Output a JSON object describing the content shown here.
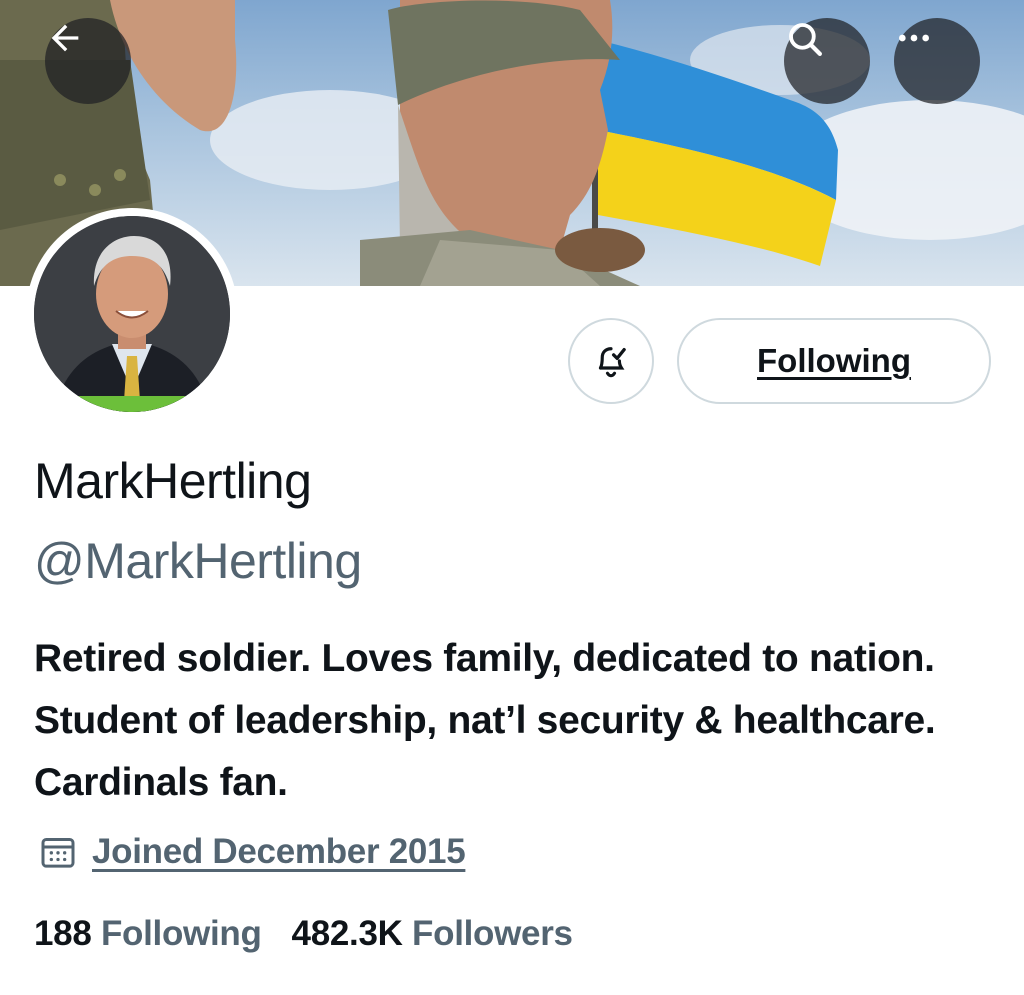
{
  "header": {
    "back_icon": "arrow-left-icon",
    "search_icon": "search-icon",
    "more_icon": "more-horizontal-icon"
  },
  "profile": {
    "display_name": "MarkHertling",
    "handle": "@MarkHertling",
    "bio": "Retired soldier. Loves family, dedicated to nation. Student of leadership, nat’l security & healthcare. Cardinals fan.",
    "joined": "Joined December 2015",
    "joined_icon": "calendar-icon"
  },
  "actions": {
    "notifications_icon": "bell-subscribed-icon",
    "following_label": "Following"
  },
  "stats": {
    "following_count": "188",
    "following_label": "Following",
    "followers_count": "482.3K",
    "followers_label": "Followers"
  },
  "colors": {
    "text_primary": "#0f1419",
    "text_secondary": "#536471",
    "border": "#cfd9de",
    "flag_blue": "#2f8fd8",
    "flag_yellow": "#f4d21a"
  }
}
